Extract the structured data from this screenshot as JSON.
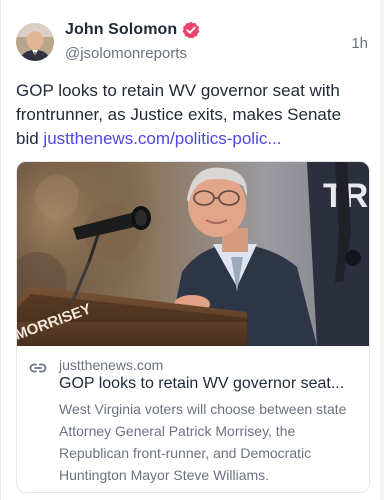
{
  "author": {
    "name": "John Solomon",
    "handle": "@jsolomonreports",
    "time": "1h"
  },
  "post": {
    "text": "GOP looks to retain WV governor seat with frontrunner, as Justice exits, makes Senate bid ",
    "link_text": "justthenews.com/politics-polic..."
  },
  "link_card": {
    "domain": "justthenews.com",
    "title": "GOP looks to retain WV governor seat...",
    "description": "West Virginia voters will choose between state Attorney General Patrick Morrisey, the Republican front-runner, and Democratic Huntington Mayor Steve Williams.",
    "image_sign_text": "MORRISEY",
    "image_banner_text": "TR"
  },
  "colors": {
    "verified_badge": "#e8436a",
    "link": "#4f46e5"
  },
  "icons": {
    "verified": "verified-badge-icon",
    "link": "link-icon"
  }
}
